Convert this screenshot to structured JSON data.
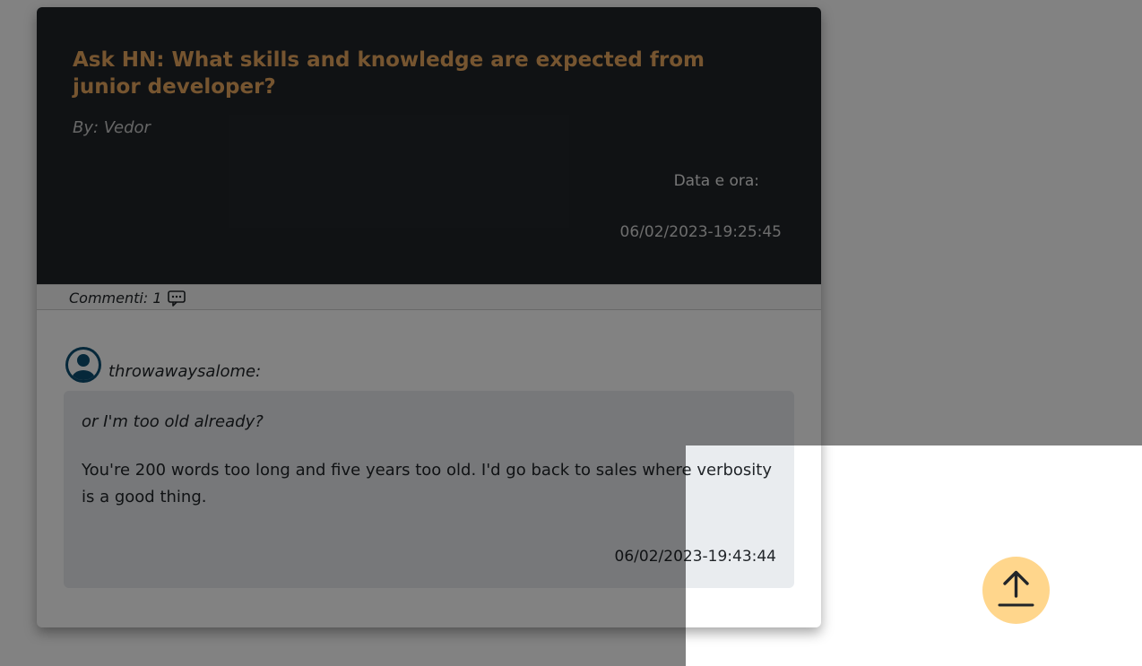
{
  "post": {
    "title": "Ask HN: What skills and knowledge are expected from junior developer?",
    "author": "By: Vedor",
    "date_label": "Data e ora:",
    "date_value": "06/02/2023-19:25:45"
  },
  "comments_bar": {
    "count_label": "Commenti: 1",
    "icon": "comment-dots-icon"
  },
  "comments": [
    {
      "avatar_icon": "person-circle-icon",
      "user": "throwawaysalome:",
      "quote": "or I'm too old already?",
      "text": "You're 200 words too long and five years too old. I'd go back to sales where verbosity is a good thing.",
      "date": "06/02/2023-19:43:44"
    }
  ],
  "scroll_button": {
    "icon": "arrow-up-to-line-icon"
  },
  "colors": {
    "header_bg": "#212529",
    "title": "#e8a85f",
    "comment_box": "#e9ecef",
    "avatar": "#0d4f73",
    "scroll_button": "#ffd68c"
  }
}
